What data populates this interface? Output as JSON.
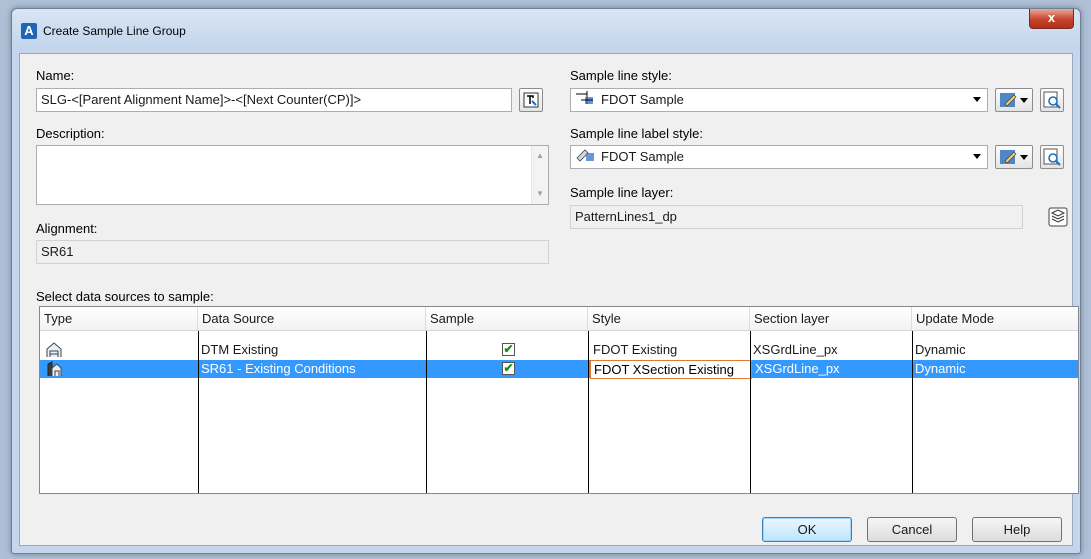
{
  "window": {
    "title": "Create Sample Line Group",
    "close_glyph": "x"
  },
  "name": {
    "label": "Name:",
    "value": "SLG-<[Parent Alignment Name]>-<[Next Counter(CP)]>"
  },
  "description": {
    "label": "Description:",
    "value": ""
  },
  "alignment": {
    "label": "Alignment:",
    "value": "SR61"
  },
  "sample_line_style": {
    "label": "Sample line style:",
    "value": "FDOT Sample"
  },
  "sample_line_label_style": {
    "label": "Sample line label style:",
    "value": "FDOT Sample"
  },
  "sample_line_layer": {
    "label": "Sample line layer:",
    "value": "PatternLines1_dp"
  },
  "sources": {
    "label": "Select data sources to sample:",
    "columns": [
      "Type",
      "Data Source",
      "Sample",
      "Style",
      "Section layer",
      "Update Mode"
    ],
    "rows": [
      {
        "data_source": "DTM Existing",
        "sample": "✔",
        "style": "FDOT Existing",
        "section_layer": "XSGrdLine_px",
        "update_mode": "Dynamic"
      },
      {
        "data_source": "SR61 - Existing Conditions",
        "sample": "✔",
        "style": "FDOT XSection Existing",
        "section_layer": "XSGrdLine_px",
        "update_mode": "Dynamic"
      }
    ],
    "selected_row": 1
  },
  "buttons": {
    "ok": "OK",
    "cancel": "Cancel",
    "help": "Help"
  },
  "colors": {
    "selection": "#3399ff",
    "titlebar": "#c5d6ec",
    "close": "#c7442d"
  }
}
